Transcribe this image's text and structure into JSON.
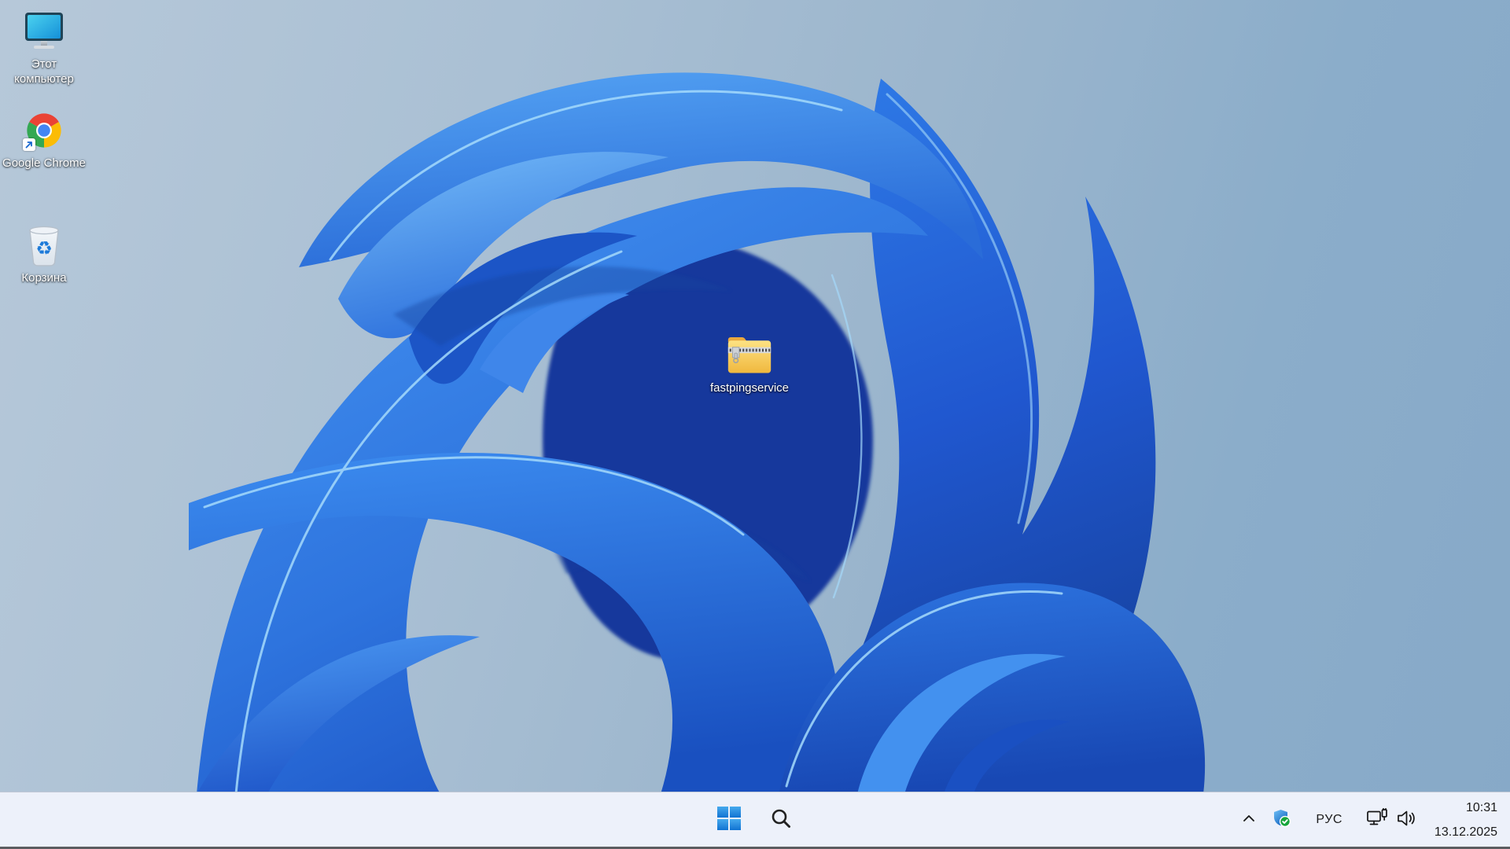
{
  "wallpaper": {
    "name": "windows-11-bloom",
    "palette": {
      "background_left": "#b6c8d9",
      "background_right": "#87a9c8",
      "bloom_primary": "#2e7de9",
      "bloom_dark": "#1747b0",
      "bloom_deep": "#123c9e",
      "bloom_highlight": "#9fd6fb"
    }
  },
  "desktop": {
    "icons": [
      {
        "id": "this-pc",
        "label": "Этот компьютер",
        "icon": "computer-monitor-icon"
      },
      {
        "id": "google-chrome",
        "label": "Google Chrome",
        "icon": "chrome-logo-icon",
        "shortcut_overlay": "shortcut-arrow"
      },
      {
        "id": "recycle-bin",
        "label": "Корзина",
        "icon": "recycle-bin-icon"
      },
      {
        "id": "fastpingservice-zip",
        "label": "fastpingservice",
        "icon": "zipped-folder-icon"
      }
    ]
  },
  "taskbar": {
    "background_color": "#edf1fa",
    "icons": {
      "start": "windows-logo",
      "search": "magnifier",
      "tray_overflow": "chevron-up",
      "security": "shield-with-green-checkmark",
      "network": "wired-network-monitor",
      "volume": "speaker-with-waves"
    },
    "tray": {
      "language": "РУС",
      "time": "10:31",
      "date": "13.12.2025"
    }
  }
}
